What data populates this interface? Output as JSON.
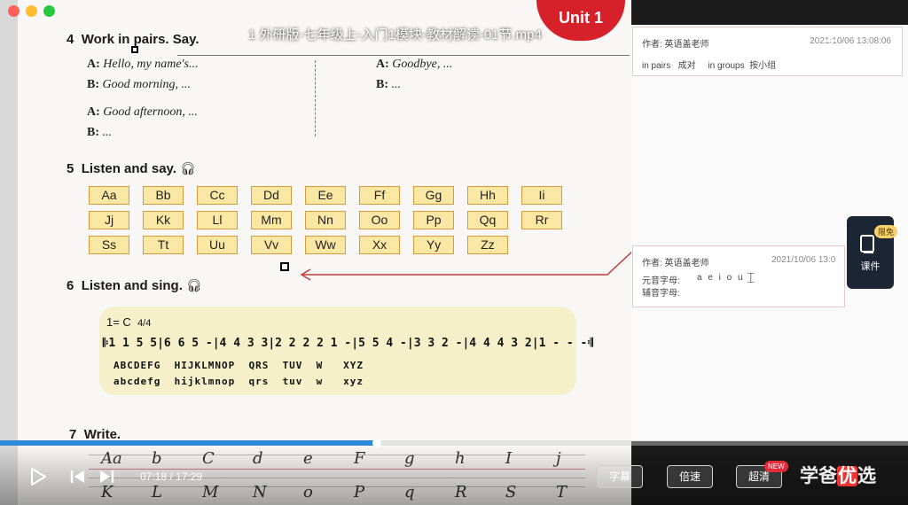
{
  "window": {
    "title": "1 外研版-七年级上-入门1模块-教材解读-01节.mp4"
  },
  "unit_badge": "Unit 1",
  "sections": {
    "s4": {
      "number": "4",
      "title": "Work in pairs. Say.",
      "lines": [
        {
          "speaker": "A:",
          "text": "Hello, my name's..."
        },
        {
          "speaker": "B:",
          "text": "Good morning, ..."
        },
        {
          "speaker": "A:",
          "text": "Good afternoon, ..."
        },
        {
          "speaker": "B:",
          "text": "..."
        },
        {
          "speaker": "A:",
          "text": "Goodbye, ..."
        },
        {
          "speaker": "B:",
          "text": "..."
        }
      ]
    },
    "s5": {
      "number": "5",
      "title": "Listen and say.",
      "letters": [
        "Aa",
        "Bb",
        "Cc",
        "Dd",
        "Ee",
        "Ff",
        "Gg",
        "Hh",
        "Ii",
        "Jj",
        "Kk",
        "Ll",
        "Mm",
        "Nn",
        "Oo",
        "Pp",
        "Qq",
        "Rr",
        "Ss",
        "Tt",
        "Uu",
        "Vv",
        "Ww",
        "Xx",
        "Yy",
        "Zz"
      ]
    },
    "s6": {
      "number": "6",
      "title": "Listen and sing.",
      "key": "1= C",
      "meter": "4/4",
      "notation": "𝄆1 1 5 5|6 6 5 -|4 4 3 3|2 2 2 2 1 -|5 5 4 -|3 3 2 -|4 4 4 3 2|1 - - -𝄇",
      "upper": "ABCDEFG  HIJKLMNOP  QRS  TUV  W   XYZ",
      "lower": "abcdefg  hijklmnop  qrs  tuv  w   xyz"
    },
    "s7": {
      "number": "7",
      "title": "Write.",
      "row1": [
        "Aa",
        "b",
        "C",
        "d",
        "e",
        "F",
        "g",
        "h",
        "I",
        "j"
      ],
      "row2": [
        "K",
        "L",
        "M",
        "N",
        "o",
        "P",
        "q",
        "R",
        "S",
        "T"
      ]
    }
  },
  "notes": [
    {
      "author": "作者: 英语盖老师",
      "time": "2021/10/06 13:08:06",
      "text": "in pairs   成对     in groups  按小组"
    },
    {
      "author": "作者: 英语盖老师",
      "time": "2021/10/06 13:0",
      "vowel_label": "元音字母:",
      "vowel_value": "a e i o u",
      "consonant_label": "辅音字母:"
    }
  ],
  "courseware": {
    "label": "课件",
    "badge": "限免"
  },
  "player": {
    "current_time": "07:18",
    "duration": "17:29",
    "time_text": "07:18 / 17:29",
    "progress": 0.415,
    "subtitle_label": "字幕",
    "speed_label": "倍速",
    "quality_label": "超清",
    "new_badge": "NEW",
    "logo_a": "学爸",
    "logo_b": "优",
    "logo_c": "选"
  },
  "colors": {
    "accent": "#2b8bd8",
    "letter_box": "#fbe7a4",
    "badge": "#d6202a"
  }
}
